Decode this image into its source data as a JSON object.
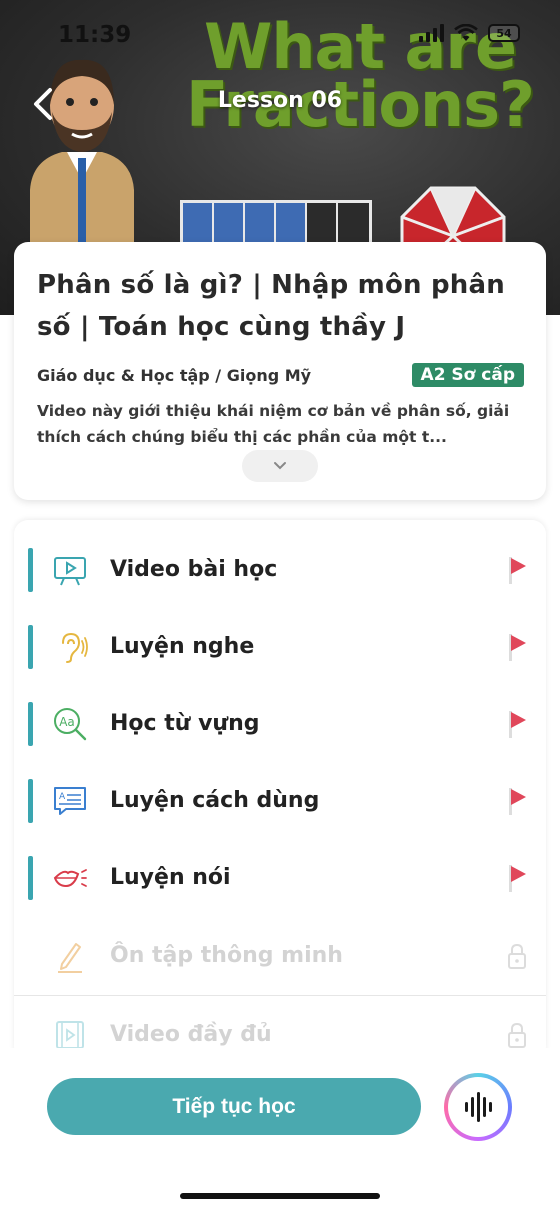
{
  "status_bar": {
    "time": "11:39",
    "battery": "54"
  },
  "header": {
    "lesson_label": "Lesson 06",
    "thumbnail_text": "What are Fractions?"
  },
  "info": {
    "title": "Phân số là gì? | Nhập môn phân số | Toán học cùng thầy J",
    "category": "Giáo dục & Học tập / Giọng Mỹ",
    "level": "A2 Sơ cấp",
    "description": "Video này giới thiệu khái niệm cơ bản về phân số, giải thích cách chúng biểu thị các phần của một t..."
  },
  "lessons": [
    {
      "label": "Video bài học",
      "icon": "video-lesson-icon",
      "locked": false
    },
    {
      "label": "Luyện nghe",
      "icon": "ear-icon",
      "locked": false
    },
    {
      "label": "Học từ vựng",
      "icon": "vocabulary-search-icon",
      "locked": false
    },
    {
      "label": "Luyện cách dùng",
      "icon": "usage-card-icon",
      "locked": false
    },
    {
      "label": "Luyện nói",
      "icon": "mouth-speaking-icon",
      "locked": false
    },
    {
      "label": "Ôn tập thông minh",
      "icon": "pencil-icon",
      "locked": true
    },
    {
      "label": "Video đầy đủ",
      "icon": "film-icon",
      "locked": true
    }
  ],
  "actions": {
    "continue_label": "Tiếp tục học"
  },
  "colors": {
    "accent": "#3aa5b0",
    "cta": "#4aa9af",
    "badge": "#2e8b66",
    "flag": "#e0475a"
  }
}
